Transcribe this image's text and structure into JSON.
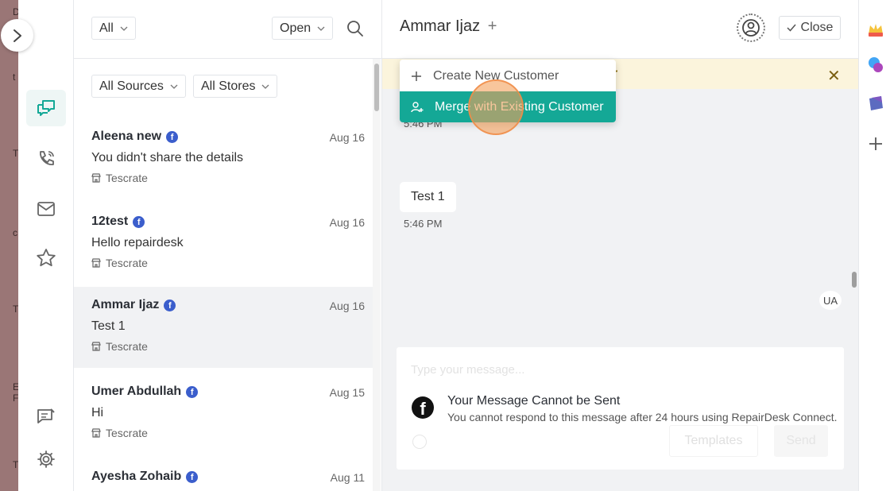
{
  "background_strip": {
    "letters": [
      "D",
      "t",
      "T",
      "c",
      "T",
      "E",
      "F",
      "T"
    ]
  },
  "nav": {
    "items": [
      "conversations",
      "calls",
      "email",
      "starred",
      "notes",
      "settings"
    ]
  },
  "list": {
    "filter_all": "All",
    "filter_status": "Open",
    "filter_sources": "All Sources",
    "filter_stores": "All Stores",
    "conversations": [
      {
        "name": "Aleena new",
        "date": "Aug 16",
        "message": "You didn't share the details",
        "store": "Tescrate",
        "selected": false
      },
      {
        "name": "12test",
        "date": "Aug 16",
        "message": "Hello repairdesk",
        "store": "Tescrate",
        "selected": false
      },
      {
        "name": "Ammar Ijaz",
        "date": "Aug 16",
        "message": "Test 1",
        "store": "Tescrate",
        "selected": true
      },
      {
        "name": "Umer Abdullah",
        "date": "Aug 15",
        "message": "Hi",
        "store": "Tescrate",
        "selected": false
      },
      {
        "name": "Ayesha Zohaib",
        "date": "Aug 11",
        "message": "",
        "store": "",
        "selected": false
      }
    ]
  },
  "chat": {
    "title": "Ammar Ijaz",
    "add_symbol": "+",
    "close_label": "Close",
    "banner_text": "r",
    "banner_close": "✕",
    "time_1": "5:46 PM",
    "bubble_text": "Test 1",
    "time_2": "5:46 PM",
    "agent_initials": "UA",
    "compose_placeholder": "Type your message...",
    "warning_title": "Your Message Cannot be Sent",
    "warning_subtitle": "You cannot respond to this message after 24 hours using RepairDesk Connect.",
    "templates_label": "Templates",
    "send_label": "Send"
  },
  "dropdown": {
    "create_label": "Create New Customer",
    "merge_label": "Merge with Existing Customer"
  },
  "colors": {
    "accent": "#14a896",
    "banner": "#fbf4dc",
    "facebook": "#3b5ecc",
    "click_marker": "#f4a05a"
  }
}
